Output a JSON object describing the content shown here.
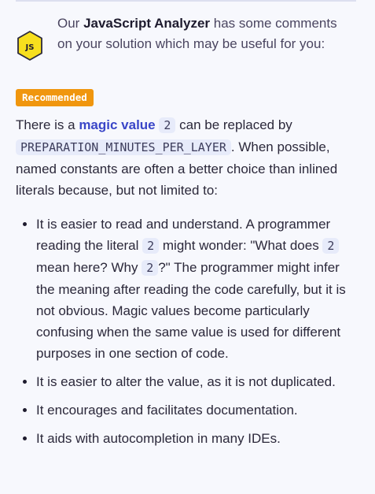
{
  "header": {
    "prefix": "Our ",
    "analyzer_name": "JavaScript Analyzer",
    "suffix": " has some comments on your solution which may be useful for you:",
    "badge_label": "JS",
    "badge_colors": {
      "fill": "#f7df1e",
      "stroke": "#2c2a3d"
    }
  },
  "tag": {
    "label": "Recommended",
    "color": "#f0960e"
  },
  "intro": {
    "t1": "There is a ",
    "highlight": "magic value",
    "code1": "2",
    "t2": " can be replaced by ",
    "code2": "PREPARATION_MINUTES_PER_LAYER",
    "t3": ". When possible, named constants are often a better choice than inlined literals because, but not limited to:"
  },
  "bullets": {
    "b1": {
      "t1": "It is easier to read and understand. A programmer reading the literal ",
      "c1": "2",
      "t2": " might wonder: \"What does ",
      "c2": "2",
      "t3": " mean here? Why ",
      "c3": "2",
      "t4": "?\" The programmer might infer the meaning after reading the code carefully, but it is not obvious. Magic values become particularly confusing when the same value is used for different purposes in one section of code."
    },
    "b2": "It is easier to alter the value, as it is not duplicated.",
    "b3": "It encourages and facilitates documentation.",
    "b4": "It aids with autocompletion in many IDEs."
  }
}
